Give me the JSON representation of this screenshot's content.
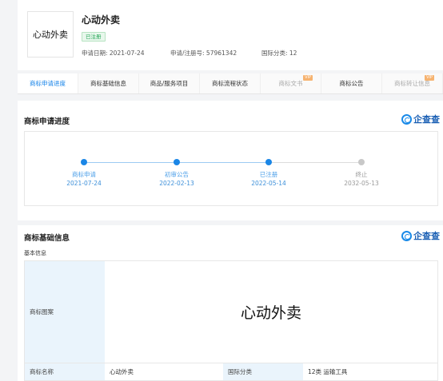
{
  "header": {
    "logo_text": "心动外卖",
    "title": "心动外卖",
    "status_badge": "已注册",
    "apply_date": "申请日期: 2021-07-24",
    "reg_no": "申请/注册号: 57961342",
    "intl_class": "国际分类: 12"
  },
  "tabs": [
    {
      "label": "商标申请进度"
    },
    {
      "label": "商标基础信息"
    },
    {
      "label": "商品/服务项目"
    },
    {
      "label": "商标流程状态"
    },
    {
      "label": "商标文书",
      "vip": "VIP"
    },
    {
      "label": "商标公告"
    },
    {
      "label": "商标转让信息",
      "vip": "VIP"
    }
  ],
  "progress": {
    "title": "商标申请进度",
    "brand": "企查查",
    "steps": [
      {
        "label": "商标申请",
        "date": "2021-07-24"
      },
      {
        "label": "初审公告",
        "date": "2022-02-13"
      },
      {
        "label": "已注册",
        "date": "2022-05-14"
      },
      {
        "label": "终止",
        "date": "2032-05-13"
      }
    ]
  },
  "info": {
    "title": "商标基础信息",
    "brand": "企查查",
    "subtitle": "基本信息",
    "mark_label": "商标图案",
    "mark_image_text": "心动外卖",
    "name_label": "商标名称",
    "name_value": "心动外卖",
    "class_label": "国际分类",
    "class_value": "12类 运输工具"
  },
  "colors": {
    "accent": "#1281e8",
    "done": "#1a86e6",
    "pending": "#c8c8c8",
    "badge_green": "#29a85a",
    "header_cell": "#eaf4fc"
  }
}
